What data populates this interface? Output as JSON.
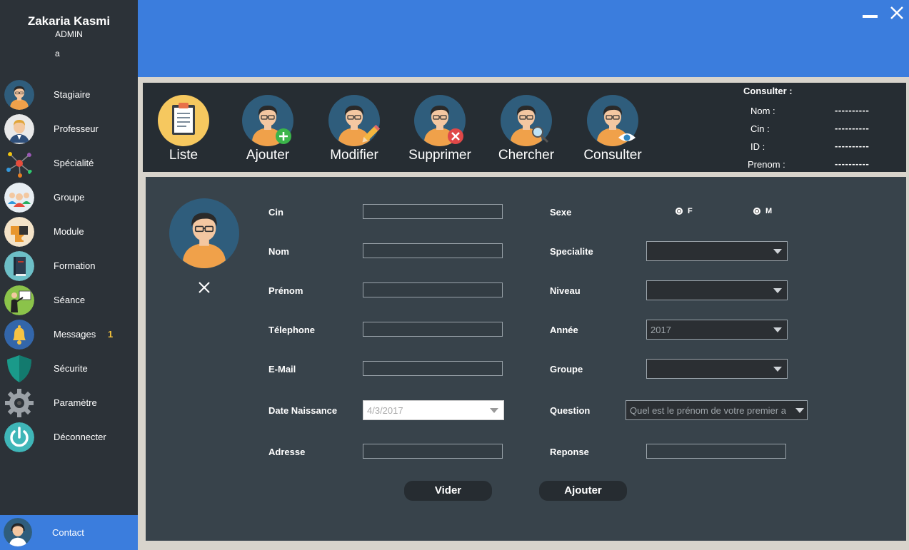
{
  "user": {
    "name": "Zakaria Kasmi",
    "role": "ADMIN",
    "extra": "a"
  },
  "sidebar": {
    "items": [
      {
        "label": "Stagiaire",
        "icon": "student-avatar-icon"
      },
      {
        "label": "Professeur",
        "icon": "teacher-avatar-icon"
      },
      {
        "label": "Spécialité",
        "icon": "network-nodes-icon"
      },
      {
        "label": "Groupe",
        "icon": "group-people-icon"
      },
      {
        "label": "Module",
        "icon": "puzzle-icon"
      },
      {
        "label": "Formation",
        "icon": "book-icon"
      },
      {
        "label": "Séance",
        "icon": "presentation-board-icon"
      },
      {
        "label": "Messages",
        "icon": "bell-icon",
        "badge": "1"
      },
      {
        "label": "Sécurite",
        "icon": "shield-icon"
      },
      {
        "label": "Paramètre",
        "icon": "gear-icon"
      },
      {
        "label": "Déconnecter",
        "icon": "power-icon"
      }
    ],
    "contact_label": "Contact"
  },
  "toolbar": {
    "liste": "Liste",
    "ajouter": "Ajouter",
    "modifier": "Modifier",
    "supprimer": "Supprimer",
    "chercher": "Chercher",
    "consulter": "Consulter"
  },
  "consult": {
    "title": "Consulter :",
    "nom_label": "Nom :",
    "cin_label": "Cin :",
    "id_label": "ID :",
    "prenom_label": "Prenom :",
    "nom_value": "----------",
    "cin_value": "----------",
    "id_value": "----------",
    "prenom_value": "----------"
  },
  "form": {
    "cin": "Cin",
    "nom": "Nom",
    "prenom": "Prénom",
    "telephone": "Télephone",
    "email": "E-Mail",
    "date_naissance": "Date Naissance",
    "date_value": "4/3/2017",
    "adresse": "Adresse",
    "sexe": "Sexe",
    "sexe_f": "F",
    "sexe_m": "M",
    "specialite": "Specialite",
    "niveau": "Niveau",
    "annee": "Année",
    "annee_value": "2017",
    "groupe": "Groupe",
    "question": "Question",
    "question_value": "Quel est le prénom de votre premier a",
    "reponse": "Reponse",
    "vider": "Vider",
    "ajouter": "Ajouter"
  },
  "colors": {
    "accent": "#3b7ddd",
    "sidebar_bg": "#2c3238",
    "panel_bg": "#38434b",
    "toolbar_bg": "#262d33",
    "badge": "#f3c13a"
  }
}
